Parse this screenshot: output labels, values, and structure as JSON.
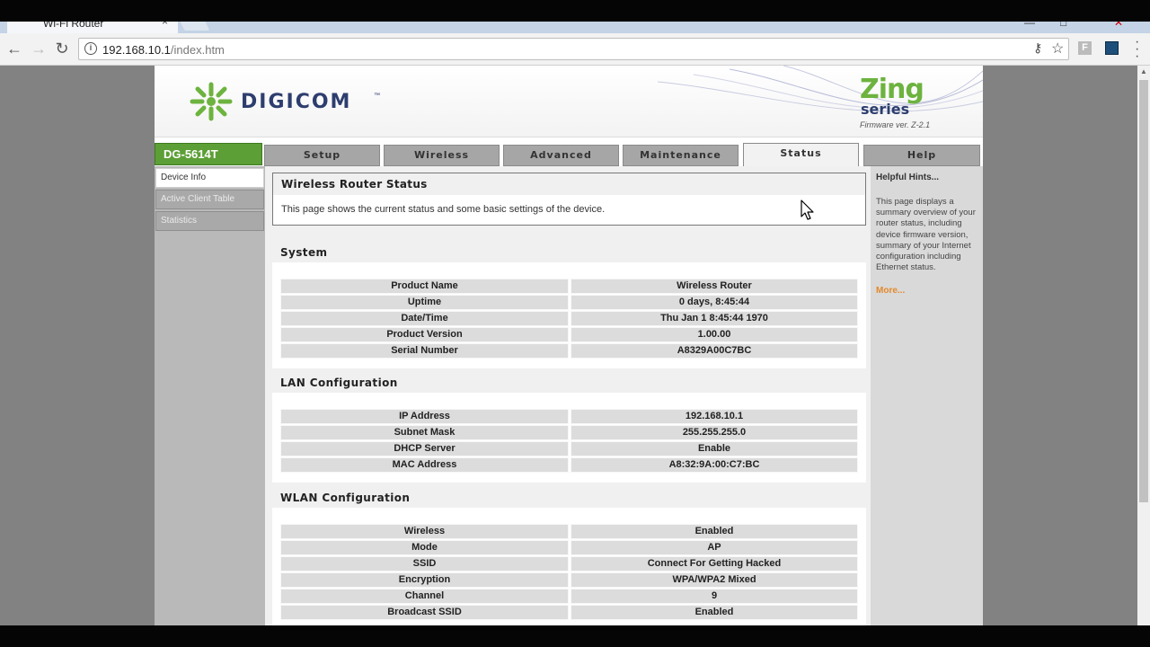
{
  "browser": {
    "tab_title": "Wi-Fi Router",
    "tab_close": "×",
    "url_host": "192.168.10.1",
    "url_path": "/index.htm",
    "ext_label": "F"
  },
  "router": {
    "brand": "DIGICOM",
    "brand_tm": "™",
    "series_top": "Zing",
    "series_bottom": "series",
    "firmware": "Firmware ver. Z-2.1",
    "model": "DG-5614T",
    "nav_tabs": [
      "Setup",
      "Wireless",
      "Advanced",
      "Maintenance",
      "Status",
      "Help"
    ],
    "active_tab": "Status",
    "left_menu": [
      "Device Info",
      "Active Client Table",
      "Statistics"
    ],
    "active_left_menu": "Device Info"
  },
  "status_box": {
    "title": "Wireless Router Status",
    "description": "This page shows the current status and some basic settings of the device."
  },
  "sections": {
    "system": {
      "title": "System",
      "rows": [
        {
          "k": "Product Name",
          "v": "Wireless Router"
        },
        {
          "k": "Uptime",
          "v": "0 days, 8:45:44"
        },
        {
          "k": "Date/Time",
          "v": "Thu Jan 1 8:45:44 1970"
        },
        {
          "k": "Product Version",
          "v": "1.00.00"
        },
        {
          "k": "Serial Number",
          "v": "A8329A00C7BC"
        }
      ]
    },
    "lan": {
      "title": "LAN Configuration",
      "rows": [
        {
          "k": "IP Address",
          "v": "192.168.10.1"
        },
        {
          "k": "Subnet Mask",
          "v": "255.255.255.0"
        },
        {
          "k": "DHCP Server",
          "v": "Enable"
        },
        {
          "k": "MAC Address",
          "v": "A8:32:9A:00:C7:BC"
        }
      ]
    },
    "wlan": {
      "title": "WLAN Configuration",
      "rows": [
        {
          "k": "Wireless",
          "v": "Enabled"
        },
        {
          "k": "Mode",
          "v": "AP"
        },
        {
          "k": "SSID",
          "v": "Connect For Getting Hacked"
        },
        {
          "k": "Encryption",
          "v": "WPA/WPA2 Mixed"
        },
        {
          "k": "Channel",
          "v": "9"
        },
        {
          "k": "Broadcast SSID",
          "v": "Enabled"
        }
      ]
    }
  },
  "hints": {
    "title": "Helpful Hints...",
    "body": "This page displays a summary overview of your router status, including device firmware version, summary of your Internet configuration including Ethernet status.",
    "more": "More..."
  },
  "colors": {
    "brand_green": "#5c9f36",
    "brand_navy": "#2d3e6e",
    "more_link": "#e3892b"
  }
}
